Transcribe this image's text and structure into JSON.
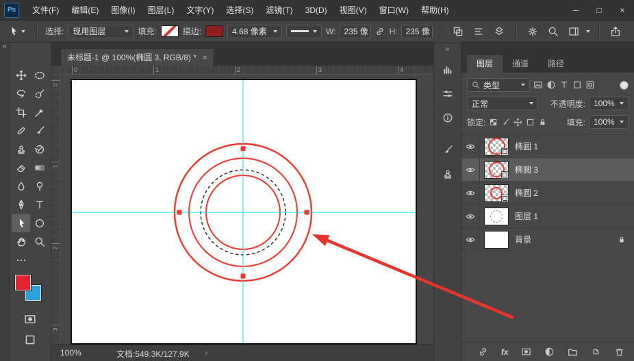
{
  "titlebar": {
    "logo": "Ps",
    "menus": [
      "文件(F)",
      "编辑(E)",
      "图像(I)",
      "图层(L)",
      "文字(Y)",
      "选择(S)",
      "滤镜(T)",
      "3D(D)",
      "视图(V)",
      "窗口(W)",
      "帮助(H)"
    ],
    "minimize": "─",
    "maximize": "□",
    "close": "×"
  },
  "options_bar": {
    "tool_icon": "path-select",
    "select_label": "选择:",
    "select_value": "现用图层",
    "fill_label": "填充:",
    "fill_slash_color": "#e03030",
    "stroke_label": "描边:",
    "stroke_swatch_color": "#8f1f1f",
    "stroke_width": "4.68 像素",
    "w_label": "W:",
    "w_value": "235 像",
    "link_icon": "link",
    "h_label": "H:",
    "h_value": "235 像",
    "right_icons": [
      "path-ops",
      "align",
      "arrange",
      "gear",
      "search",
      "workspace",
      "share"
    ]
  },
  "toolbar": {
    "collapse": "«",
    "tools": [
      {
        "icon": "move"
      },
      {
        "icon": "marquee"
      },
      {
        "icon": "lasso"
      },
      {
        "icon": "quick-select"
      },
      {
        "icon": "crop"
      },
      {
        "icon": "eyedropper"
      },
      {
        "icon": "healing"
      },
      {
        "icon": "brush"
      },
      {
        "icon": "stamp"
      },
      {
        "icon": "history-brush"
      },
      {
        "icon": "eraser"
      },
      {
        "icon": "gradient"
      },
      {
        "icon": "blur"
      },
      {
        "icon": "dodge"
      },
      {
        "icon": "pen"
      },
      {
        "icon": "type"
      },
      {
        "icon": "path-select",
        "selected": true
      },
      {
        "icon": "ellipse"
      },
      {
        "icon": "hand"
      },
      {
        "icon": "zoom"
      },
      {
        "icon": "more"
      }
    ],
    "foreground_color": "#e8232d",
    "background_color": "#2aa2dc"
  },
  "canvas": {
    "tab_title": "未标题-1 @ 100%(椭圆 3, RGB/8) *",
    "tab_close": "×",
    "ruler_top": [
      "0",
      "1",
      "2",
      "3",
      "4"
    ],
    "ruler_left": [
      "0",
      "1",
      "2",
      "3"
    ],
    "guide_color": "#00e6e6",
    "shape_color": "#f5342c",
    "dash_color": "#141414",
    "status_zoom": "100%",
    "status_doc": "文档:549.3K/127.9K",
    "status_chevron": "›"
  },
  "dock": {
    "collapse": "«",
    "icons": [
      "histogram",
      "sliders",
      "info",
      "brush",
      "stamp"
    ]
  },
  "layers_panel": {
    "tabs": [
      "图层",
      "通道",
      "路径"
    ],
    "filter_search_icon": "search",
    "filter_value": "类型",
    "filter_icons": [
      "pixel",
      "adjust",
      "type",
      "frame",
      "smart"
    ],
    "blend_value": "正常",
    "opacity_label": "不透明度:",
    "opacity_value": "100%",
    "lock_label": "锁定:",
    "lock_icons": [
      "checker",
      "brush",
      "move",
      "frame",
      "lock"
    ],
    "fill_label": "填充:",
    "fill_value": "100%",
    "layers": [
      {
        "name": "椭圆 1",
        "kind": "shape"
      },
      {
        "name": "椭圆 3",
        "kind": "shape",
        "selected": true
      },
      {
        "name": "椭圆 2",
        "kind": "shape"
      },
      {
        "name": "图层 1",
        "kind": "pixel"
      },
      {
        "name": "背景",
        "kind": "background",
        "locked": true
      }
    ],
    "fx_label": "fx",
    "bottom_icons": [
      "link",
      "mask",
      "adjust",
      "folder",
      "new-layer",
      "trash"
    ]
  },
  "annotation": {
    "arrow_color": "#e8352b"
  }
}
